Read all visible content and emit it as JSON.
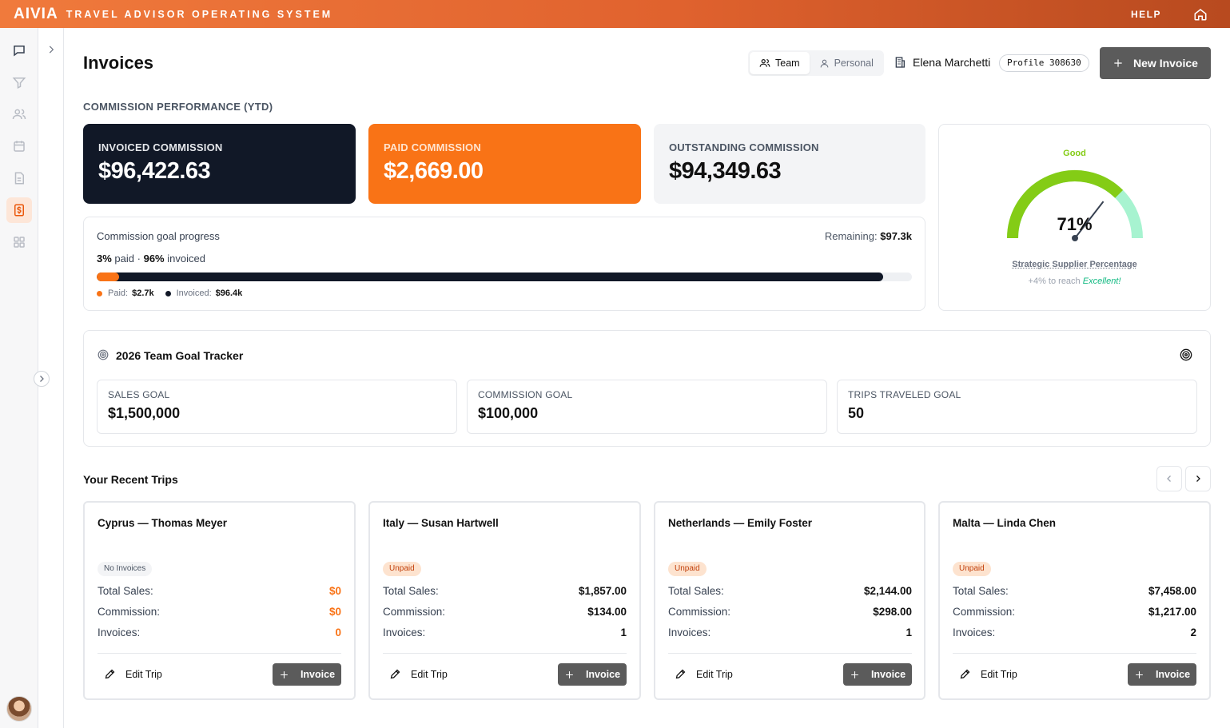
{
  "topbar": {
    "logo": "AIVIA",
    "app_title": "TRAVEL ADVISOR OPERATING SYSTEM",
    "help": "HELP"
  },
  "header": {
    "title": "Invoices",
    "toggle": {
      "team": "Team",
      "personal": "Personal"
    },
    "agency_name": "Elena Marchetti",
    "profile": "Profile 308630",
    "new_invoice": "New Invoice"
  },
  "commission": {
    "section_label": "COMMISSION PERFORMANCE (YTD)",
    "invoiced": {
      "label": "INVOICED COMMISSION",
      "value": "$96,422.63"
    },
    "paid": {
      "label": "PAID COMMISSION",
      "value": "$2,669.00"
    },
    "outstanding": {
      "label": "OUTSTANDING COMMISSION",
      "value": "$94,349.63"
    }
  },
  "goal_progress": {
    "title": "Commission goal progress",
    "remaining_label": "Remaining:",
    "remaining_value": "$97.3k",
    "paid_pct_text": "3%",
    "paid_word": "paid",
    "sep": "·",
    "invoiced_pct_text": "96%",
    "invoiced_word": "invoiced",
    "paid_fraction": 0.027,
    "invoiced_fraction": 0.965,
    "legend_paid_label": "Paid:",
    "legend_paid_value": "$2.7k",
    "legend_invoiced_label": "Invoiced:",
    "legend_invoiced_value": "$96.4k"
  },
  "gauge": {
    "status": "Good",
    "value_text": "71%",
    "value": 71,
    "label": "Strategic Supplier Percentage",
    "hint_prefix": "+4% to reach",
    "hint_target": "Excellent!"
  },
  "team_tracker": {
    "title": "2026 Team Goal Tracker",
    "goals": [
      {
        "label": "SALES GOAL",
        "value": "$1,500,000"
      },
      {
        "label": "COMMISSION GOAL",
        "value": "$100,000"
      },
      {
        "label": "TRIPS TRAVELED GOAL",
        "value": "50"
      }
    ]
  },
  "recent_trips": {
    "title": "Your Recent Trips",
    "labels": {
      "total_sales": "Total Sales:",
      "commission": "Commission:",
      "invoices": "Invoices:",
      "edit_trip": "Edit Trip",
      "invoice": "Invoice"
    },
    "trips": [
      {
        "name": "Cyprus — Thomas Meyer",
        "badge": "No Invoices",
        "total_sales": "$0",
        "commission": "$0",
        "invoices": "0"
      },
      {
        "name": "Italy — Susan Hartwell",
        "badge": "Unpaid",
        "total_sales": "$1,857.00",
        "commission": "$134.00",
        "invoices": "1"
      },
      {
        "name": "Netherlands — Emily Foster",
        "badge": "Unpaid",
        "total_sales": "$2,144.00",
        "commission": "$298.00",
        "invoices": "1"
      },
      {
        "name": "Malta — Linda Chen",
        "badge": "Unpaid",
        "total_sales": "$7,458.00",
        "commission": "$1,217.00",
        "invoices": "2"
      }
    ]
  },
  "colors": {
    "accent": "#f97316",
    "dark": "#111827",
    "gauge_good": "#84cc16",
    "gauge_excellent": "#a7f3d0",
    "button": "#5b5b5b"
  },
  "icons": [
    "chat-icon",
    "filter-icon",
    "users-icon",
    "calendar-icon",
    "document-icon",
    "invoice-dollar-icon",
    "grid-icon",
    "home-icon",
    "building-icon",
    "target-icon",
    "pencil-icon",
    "plus-icon"
  ]
}
